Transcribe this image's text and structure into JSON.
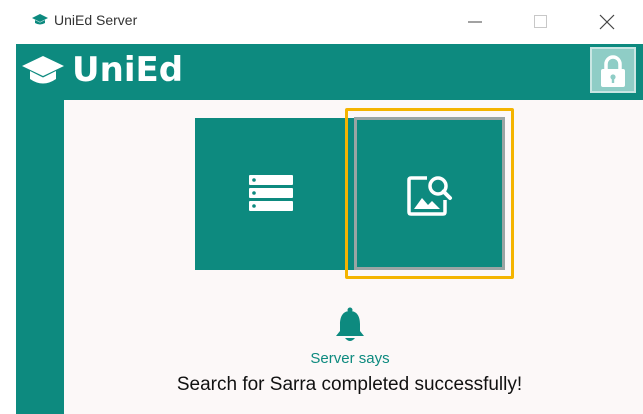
{
  "window": {
    "title": "UniEd Server",
    "controls": [
      "minimize-icon",
      "maximize-icon",
      "close-icon"
    ]
  },
  "appbar": {
    "logo_text": "UniEd",
    "logo_icon": "graduation-cap-icon",
    "lock_icon": "lock-icon"
  },
  "tiles": [
    {
      "icon": "list-icon",
      "selected": false
    },
    {
      "icon": "image-search-icon",
      "selected": true
    }
  ],
  "notification": {
    "icon": "bell-icon",
    "heading": "Server says",
    "message": "Search for Sarra completed successfully!"
  },
  "colors": {
    "primary": "#0d8a7f",
    "selection_outline": "#f4b400",
    "content_bg": "#fcf8f8"
  }
}
